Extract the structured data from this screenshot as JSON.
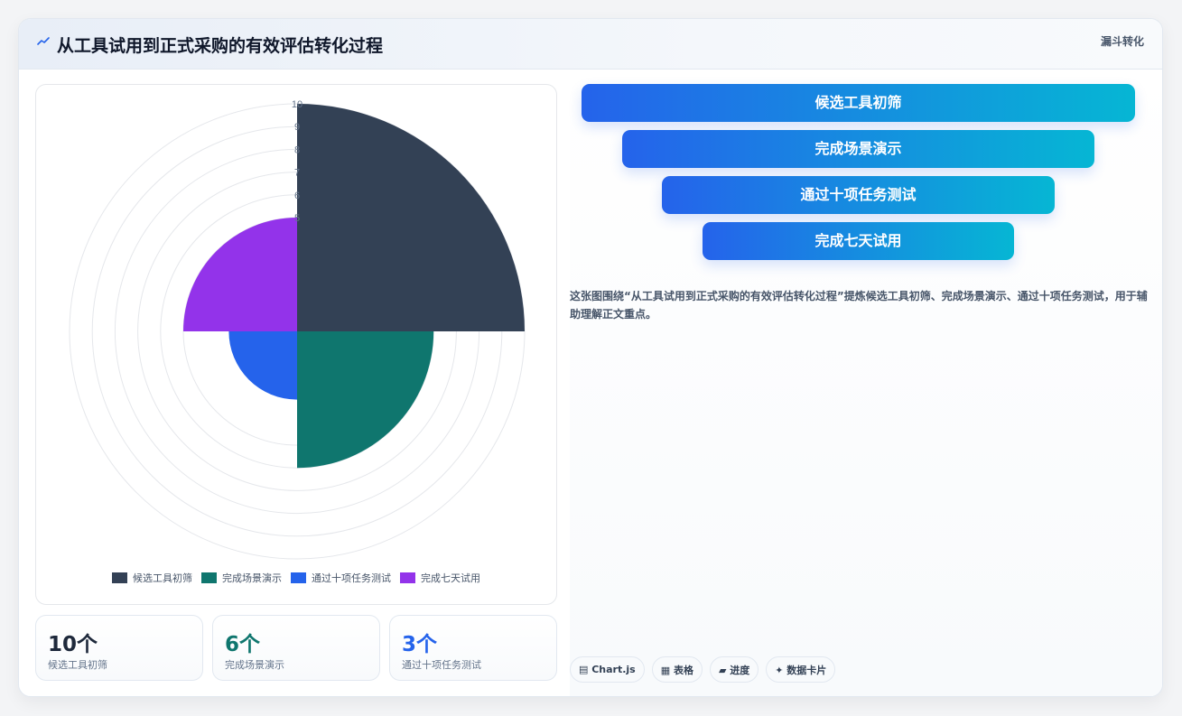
{
  "header": {
    "title": "从工具试用到正式采购的有效评估转化过程",
    "tag": "漏斗转化"
  },
  "chart_data": {
    "type": "polarArea",
    "categories": [
      "候选工具初筛",
      "完成场景演示",
      "通过十项任务测试",
      "完成七天试用"
    ],
    "values": [
      10,
      6,
      3,
      5
    ],
    "colors": [
      "#334155",
      "#0f766e",
      "#2563eb",
      "#9333ea"
    ],
    "r_range": [
      0,
      10
    ],
    "r_ticks": [
      5,
      6,
      7,
      8,
      9,
      10
    ],
    "legend_position": "bottom",
    "grid": true
  },
  "stats": [
    {
      "value": "10个",
      "label": "候选工具初筛",
      "color": "#1e293b"
    },
    {
      "value": "6个",
      "label": "完成场景演示",
      "color": "#0f766e"
    },
    {
      "value": "3个",
      "label": "通过十项任务测试",
      "color": "#2563eb"
    }
  ],
  "funnel": [
    "候选工具初筛",
    "完成场景演示",
    "通过十项任务测试",
    "完成七天试用"
  ],
  "description": "这张图围绕“从工具试用到正式采购的有效评估转化过程”提炼候选工具初筛、完成场景演示、通过十项任务测试，用于辅助理解正文重点。",
  "chips": [
    "▤ Chart.js",
    "▦ 表格",
    "▰ 进度",
    "✦ 数据卡片"
  ]
}
